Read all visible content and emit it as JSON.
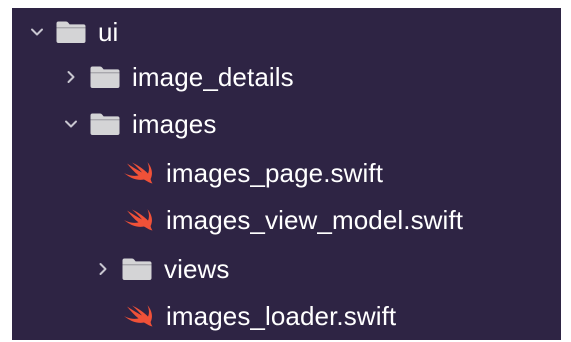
{
  "colors": {
    "background": "#2e2444",
    "text": "#ffffff",
    "folder": "#d4d4d6",
    "chevron": "#c8c6d0",
    "swift": "#f05138"
  },
  "tree": [
    {
      "label": "ui",
      "kind": "folder",
      "state": "expanded",
      "depth": 0,
      "icon": "folder-icon"
    },
    {
      "label": "image_details",
      "kind": "folder",
      "state": "collapsed",
      "depth": 1,
      "icon": "folder-icon"
    },
    {
      "label": "images",
      "kind": "folder",
      "state": "expanded",
      "depth": 1,
      "icon": "folder-icon"
    },
    {
      "label": "images_page.swift",
      "kind": "file",
      "depth": 2,
      "icon": "swift-icon"
    },
    {
      "label": "images_view_model.swift",
      "kind": "file",
      "depth": 2,
      "icon": "swift-icon"
    },
    {
      "label": "views",
      "kind": "folder",
      "state": "collapsed",
      "depth": 2,
      "icon": "folder-icon"
    },
    {
      "label": "images_loader.swift",
      "kind": "file",
      "depth": 2,
      "icon": "swift-icon"
    }
  ]
}
